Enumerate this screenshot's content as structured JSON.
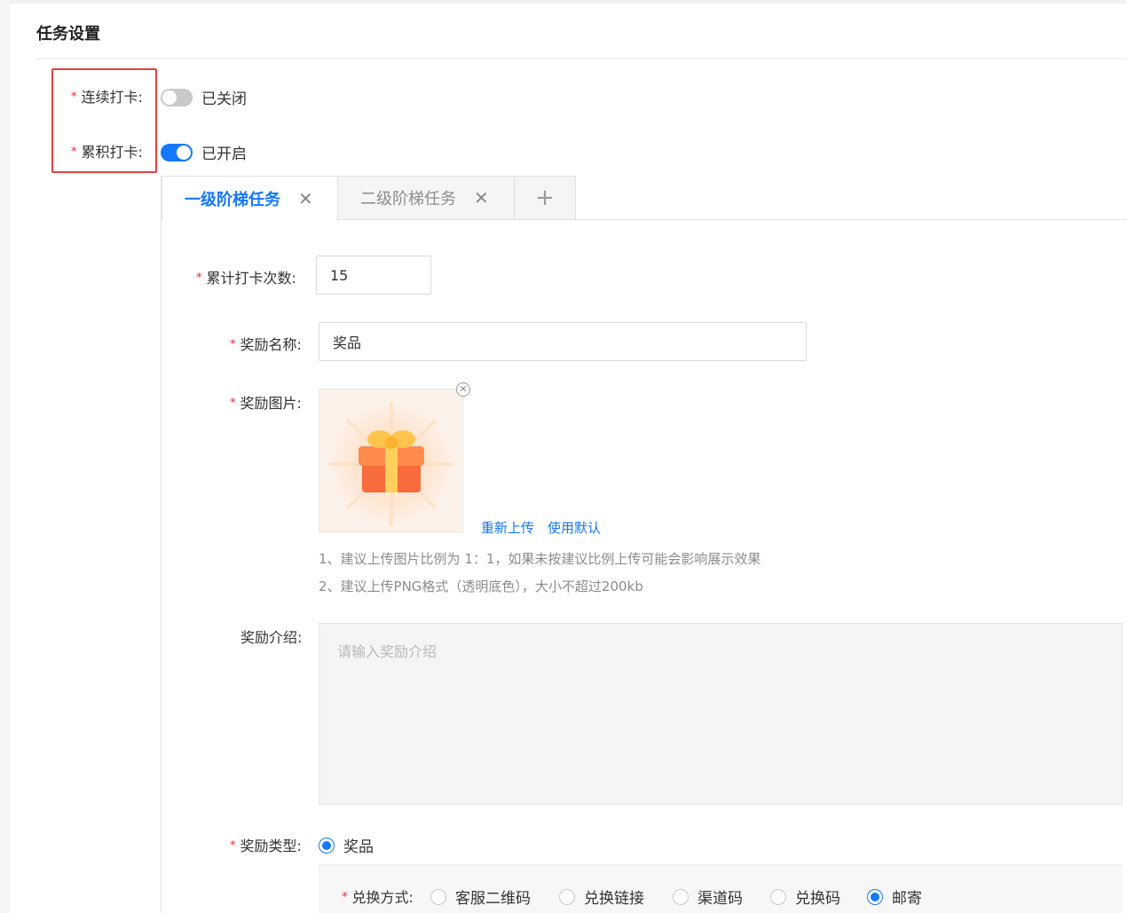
{
  "section": {
    "title": "任务设置"
  },
  "checkin": {
    "continuous": {
      "label": "连续打卡:",
      "state": "已关闭",
      "enabled": false
    },
    "cumulative": {
      "label": "累积打卡:",
      "state": "已开启",
      "enabled": true
    }
  },
  "tabs": [
    {
      "label": "一级阶梯任务",
      "active": true
    },
    {
      "label": "二级阶梯任务",
      "active": false
    }
  ],
  "add_tab_icon": "plus-icon",
  "form": {
    "count": {
      "label": "累计打卡次数:",
      "value": "15"
    },
    "reward_name": {
      "label": "奖励名称:",
      "value": "奖品"
    },
    "reward_image": {
      "label": "奖励图片:",
      "reupload": "重新上传",
      "use_default": "使用默认",
      "hint1": "1、建议上传图片比例为 1：1，如果未按建议比例上传可能会影响展示效果",
      "hint2": "2、建议上传PNG格式（透明底色），大小不超过200kb"
    },
    "reward_intro": {
      "label": "奖励介绍:",
      "placeholder": "请输入奖励介绍",
      "value": ""
    },
    "reward_type": {
      "label": "奖励类型:",
      "options": [
        "奖品"
      ],
      "selected": "奖品"
    },
    "redeem": {
      "label": "兑换方式:",
      "options": [
        "客服二维码",
        "兑换链接",
        "渠道码",
        "兑换码",
        "邮寄"
      ],
      "selected": "邮寄"
    }
  },
  "colors": {
    "primary": "#1677ff",
    "required": "#f5222d",
    "highlight": "#e0443a"
  }
}
